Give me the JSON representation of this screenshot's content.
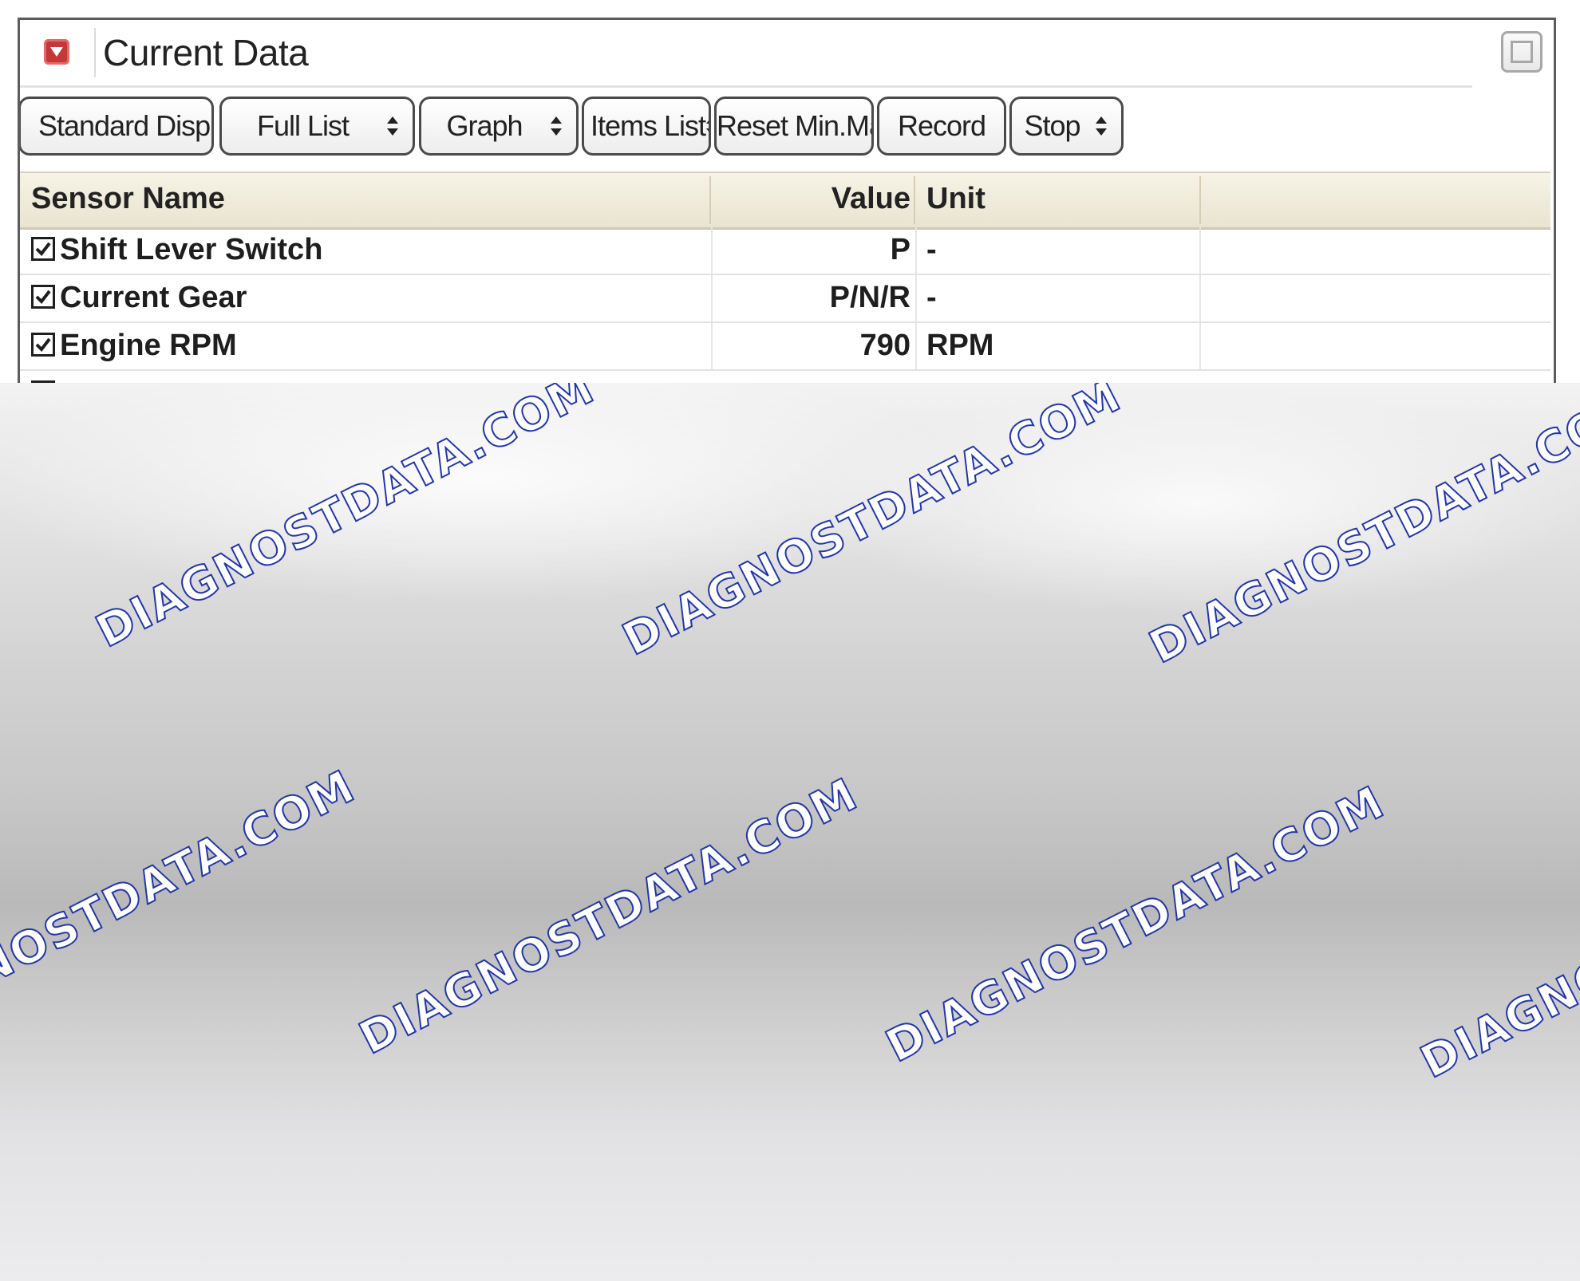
{
  "window": {
    "title": "Current Data",
    "title_icon": "collapse-icon",
    "maximize_icon": "maximize-icon"
  },
  "toolbar": {
    "buttons": [
      {
        "label": "Standard Display",
        "has_arrows": true
      },
      {
        "label": "Full List",
        "has_arrows": true
      },
      {
        "label": "Graph",
        "has_arrows": true
      },
      {
        "label": "Items List",
        "has_arrows": true
      },
      {
        "label": "Reset Min.Max.",
        "has_arrows": false
      },
      {
        "label": "Record",
        "has_arrows": false
      },
      {
        "label": "Stop",
        "has_arrows": true
      }
    ]
  },
  "table": {
    "headers": {
      "sensor": "Sensor Name",
      "value": "Value",
      "unit": "Unit"
    },
    "rows": [
      {
        "checked": true,
        "name": "Shift Lever Switch",
        "value": "P",
        "unit": "-"
      },
      {
        "checked": true,
        "name": "Current Gear",
        "value": "P/N/R",
        "unit": "-"
      },
      {
        "checked": true,
        "name": "Engine RPM",
        "value": "790",
        "unit": "RPM"
      }
    ]
  },
  "watermark": {
    "text": "DIAGNOSTDATA.COM",
    "stroke_color": "#2336a7"
  }
}
